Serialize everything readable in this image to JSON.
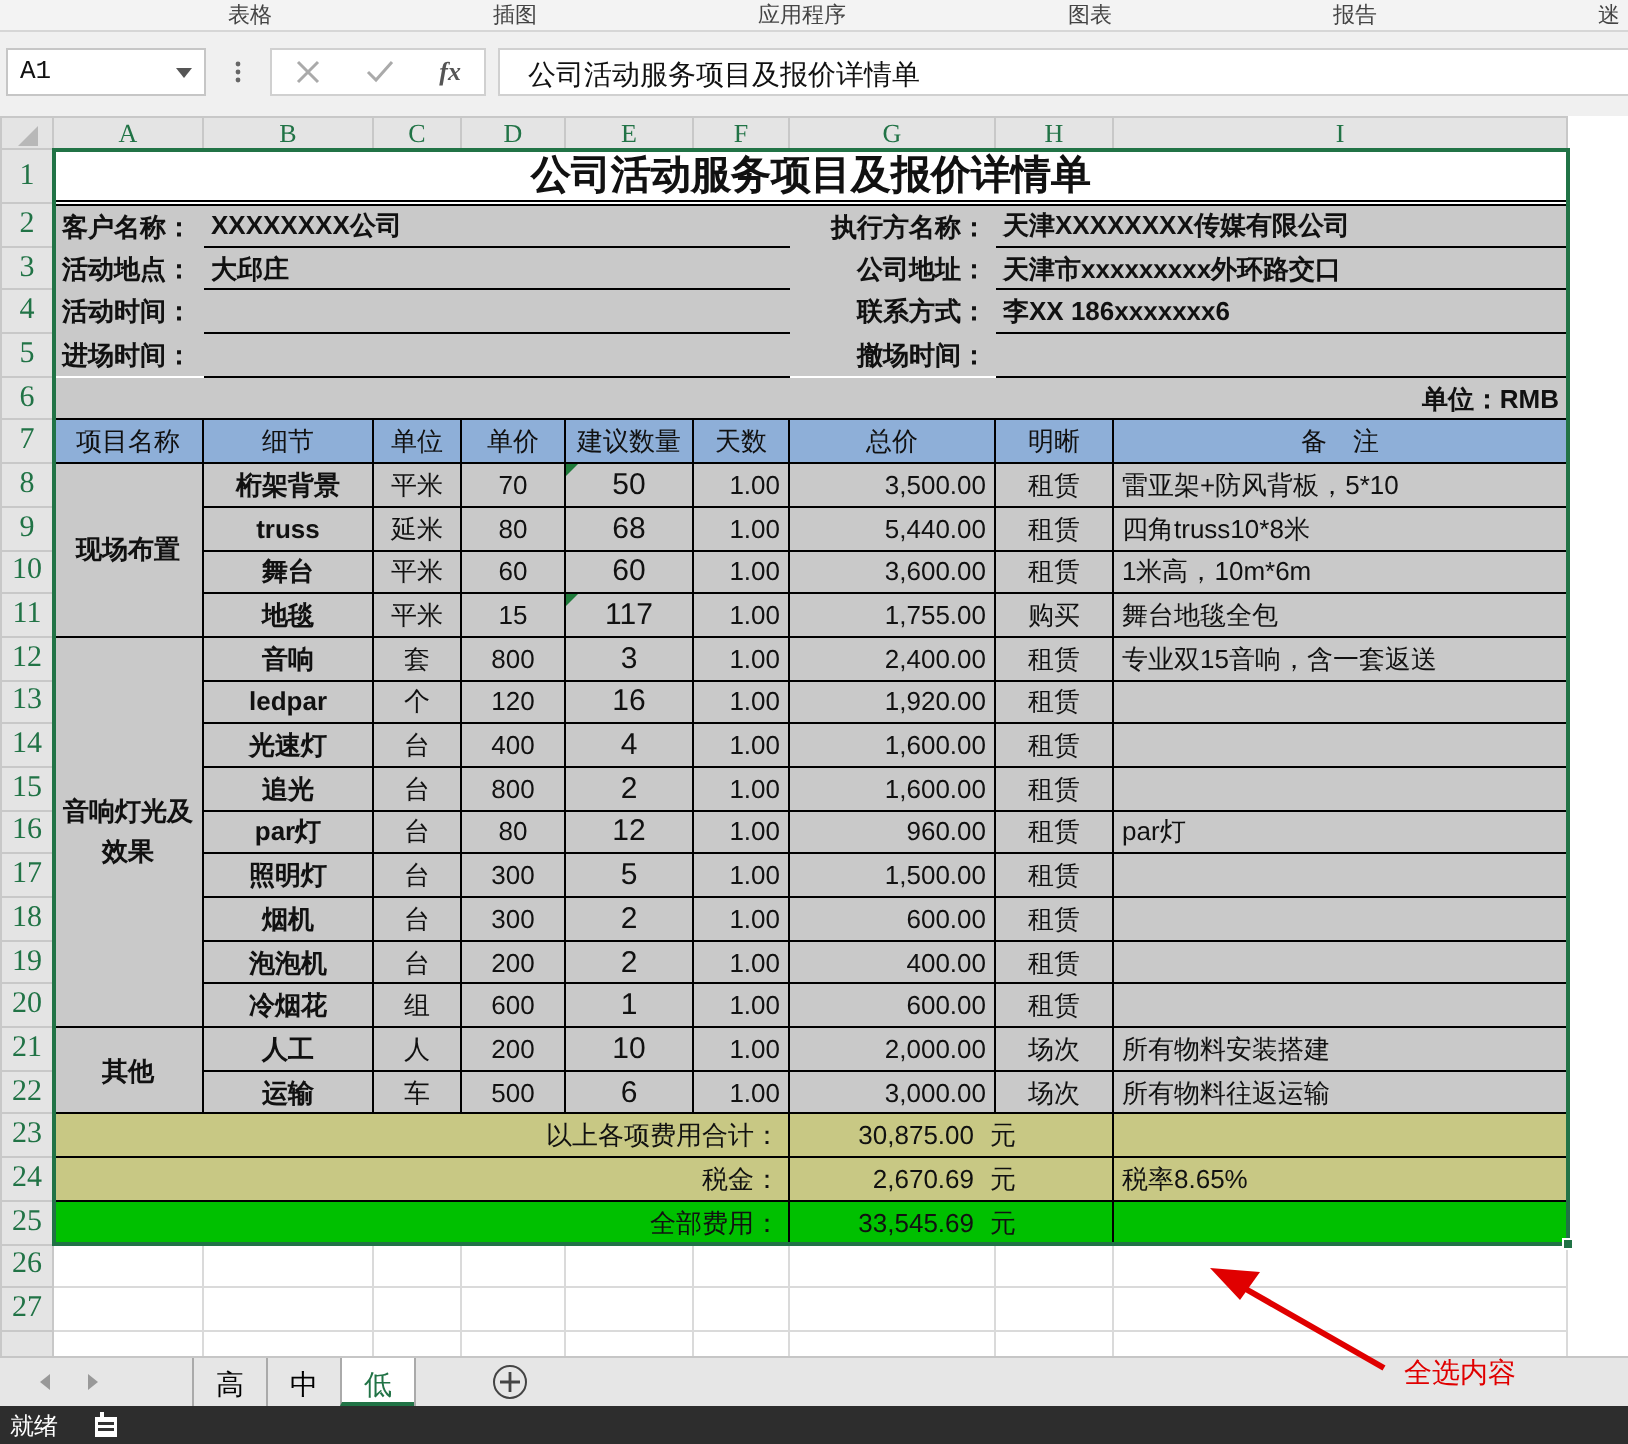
{
  "ribbon_groups": [
    "表格",
    "插图",
    "应用程序",
    "图表",
    "报告",
    "迷"
  ],
  "formula_bar": {
    "cell_ref": "A1",
    "fx": "fx",
    "formula": "公司活动服务项目及报价详情单"
  },
  "columns": [
    "A",
    "B",
    "C",
    "D",
    "E",
    "F",
    "G",
    "H",
    "I"
  ],
  "row_numbers": [
    "1",
    "2",
    "3",
    "4",
    "5",
    "6",
    "7",
    "8",
    "9",
    "10",
    "11",
    "12",
    "13",
    "14",
    "15",
    "16",
    "17",
    "18",
    "19",
    "20",
    "21",
    "22",
    "23",
    "24",
    "25",
    "26",
    "27"
  ],
  "sheet": {
    "title": "公司活动服务项目及报价详情单",
    "info": [
      {
        "left_label": "客户名称：",
        "left_value": "XXXXXXXX公司",
        "right_label": "执行方名称：",
        "right_value": "天津XXXXXXXX传媒有限公司"
      },
      {
        "left_label": "活动地点：",
        "left_value": "大邱庄",
        "right_label": "公司地址：",
        "right_value": "天津市xxxxxxxxx外环路交口"
      },
      {
        "left_label": "活动时间：",
        "right_label": "联系方式：",
        "right_value": "李XX 186xxxxxxx6"
      },
      {
        "left_label": "进场时间：",
        "right_label": "撤场时间："
      }
    ],
    "unit": "单位：RMB",
    "headers": [
      "项目名称",
      "细节",
      "单位",
      "单价",
      "建议数量",
      "天数",
      "总价",
      "明晰",
      "备　注"
    ],
    "groups": [
      {
        "name": "现场布置",
        "items": [
          {
            "detail": "桁架背景",
            "unit": "平米",
            "price": "70",
            "qty": "50",
            "flag": true,
            "days": "1.00",
            "total": "3,500.00",
            "type": "租赁",
            "note": "雷亚架+防风背板，5*10"
          },
          {
            "detail": "truss",
            "unit": "延米",
            "price": "80",
            "qty": "68",
            "flag": false,
            "days": "1.00",
            "total": "5,440.00",
            "type": "租赁",
            "note": "四角truss10*8米"
          },
          {
            "detail": "舞台",
            "unit": "平米",
            "price": "60",
            "qty": "60",
            "flag": false,
            "days": "1.00",
            "total": "3,600.00",
            "type": "租赁",
            "note": "1米高，10m*6m"
          },
          {
            "detail": "地毯",
            "unit": "平米",
            "price": "15",
            "qty": "117",
            "flag": true,
            "days": "1.00",
            "total": "1,755.00",
            "type": "购买",
            "note": "舞台地毯全包"
          }
        ]
      },
      {
        "name": "音响灯光及效果",
        "items": [
          {
            "detail": "音响",
            "unit": "套",
            "price": "800",
            "qty": "3",
            "flag": false,
            "days": "1.00",
            "total": "2,400.00",
            "type": "租赁",
            "note": "专业双15音响，含一套返送"
          },
          {
            "detail": "ledpar",
            "unit": "个",
            "price": "120",
            "qty": "16",
            "flag": false,
            "days": "1.00",
            "total": "1,920.00",
            "type": "租赁"
          },
          {
            "detail": "光速灯",
            "unit": "台",
            "price": "400",
            "qty": "4",
            "flag": false,
            "days": "1.00",
            "total": "1,600.00",
            "type": "租赁"
          },
          {
            "detail": "追光",
            "unit": "台",
            "price": "800",
            "qty": "2",
            "flag": false,
            "days": "1.00",
            "total": "1,600.00",
            "type": "租赁"
          },
          {
            "detail": "par灯",
            "unit": "台",
            "price": "80",
            "qty": "12",
            "flag": false,
            "days": "1.00",
            "total": "960.00",
            "type": "租赁",
            "note": "par灯"
          },
          {
            "detail": "照明灯",
            "unit": "台",
            "price": "300",
            "qty": "5",
            "flag": false,
            "days": "1.00",
            "total": "1,500.00",
            "type": "租赁"
          },
          {
            "detail": "烟机",
            "unit": "台",
            "price": "300",
            "qty": "2",
            "flag": false,
            "days": "1.00",
            "total": "600.00",
            "type": "租赁"
          },
          {
            "detail": "泡泡机",
            "unit": "台",
            "price": "200",
            "qty": "2",
            "flag": false,
            "days": "1.00",
            "total": "400.00",
            "type": "租赁"
          },
          {
            "detail": "冷烟花",
            "unit": "组",
            "price": "600",
            "qty": "1",
            "flag": false,
            "days": "1.00",
            "total": "600.00",
            "type": "租赁"
          }
        ]
      },
      {
        "name": "其他",
        "items": [
          {
            "detail": "人工",
            "unit": "人",
            "price": "200",
            "qty": "10",
            "flag": false,
            "days": "1.00",
            "total": "2,000.00",
            "type": "场次",
            "note": "所有物料安装搭建"
          },
          {
            "detail": "运输",
            "unit": "车",
            "price": "500",
            "qty": "6",
            "flag": false,
            "days": "1.00",
            "total": "3,000.00",
            "type": "场次",
            "note": "所有物料往返运输"
          }
        ]
      }
    ],
    "summary": [
      {
        "kind": "subtotal",
        "label": "以上各项费用合计：",
        "value": "30,875.00",
        "currency": "元"
      },
      {
        "kind": "tax",
        "label": "税金：",
        "value": "2,670.69",
        "currency": "元",
        "note": "税率8.65%"
      },
      {
        "kind": "grand",
        "label": "全部费用：",
        "value": "33,545.69",
        "currency": "元"
      }
    ]
  },
  "sheet_tabs": [
    {
      "label": "高",
      "selected": false
    },
    {
      "label": "中",
      "selected": false
    },
    {
      "label": "低",
      "selected": true
    }
  ],
  "status_bar": {
    "text": "就绪"
  },
  "annotation": {
    "text": "全选内容"
  }
}
